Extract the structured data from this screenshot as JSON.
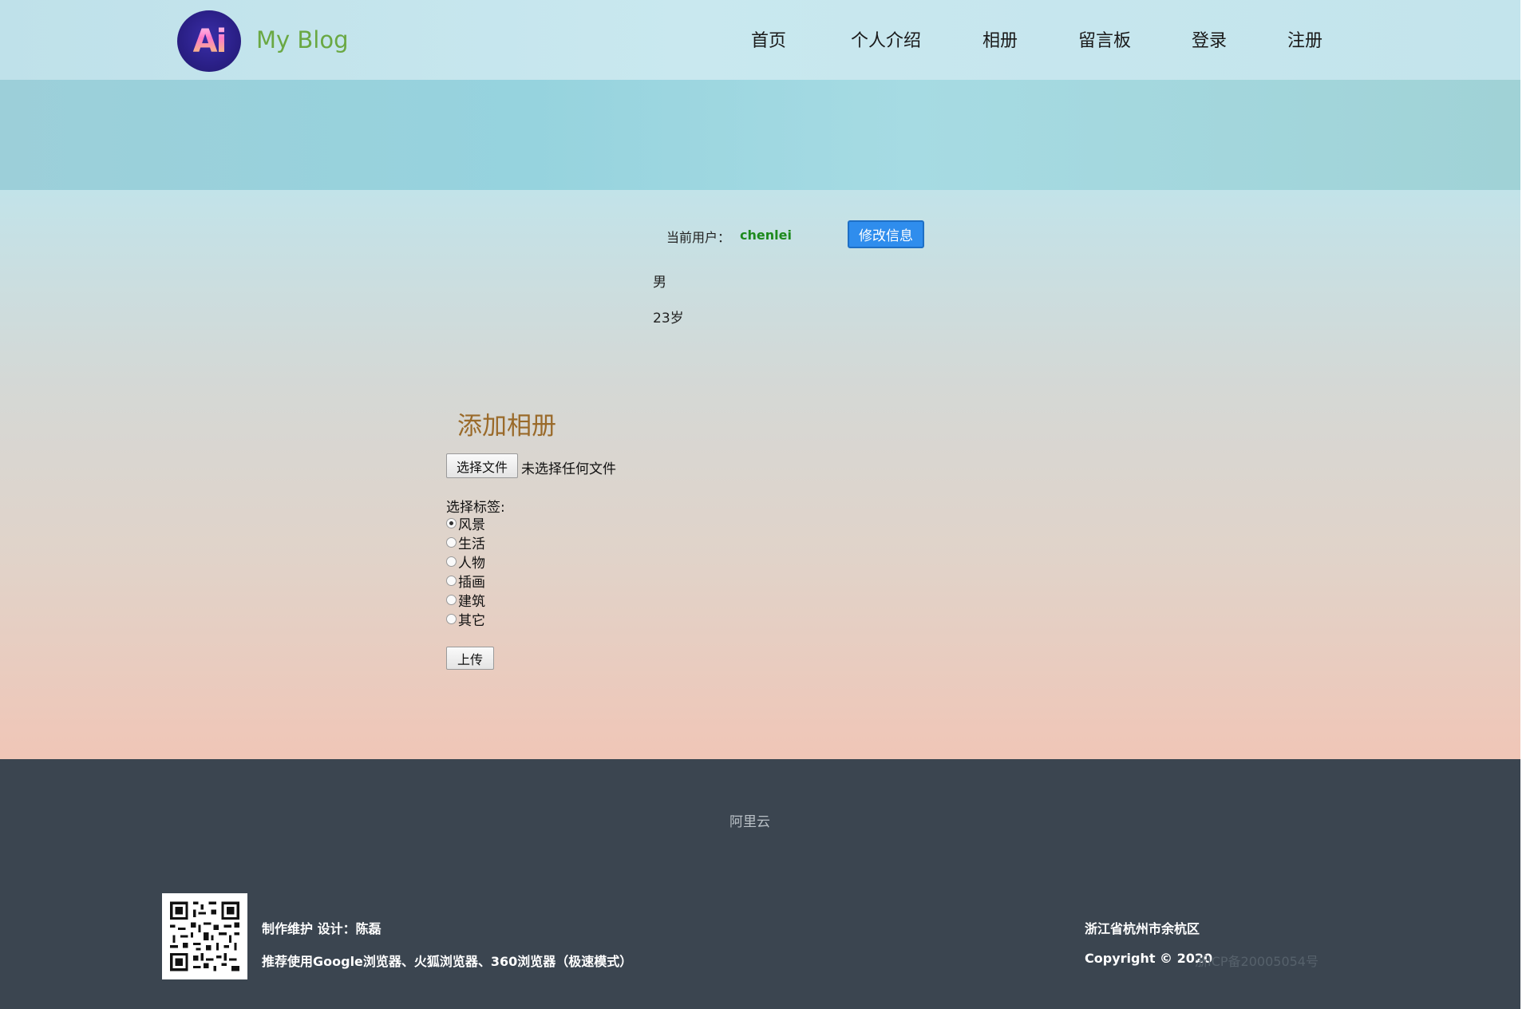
{
  "header": {
    "logo_text": "Ai",
    "site_title": "My Blog",
    "nav": [
      {
        "label": "首页"
      },
      {
        "label": "个人介绍"
      },
      {
        "label": "相册"
      },
      {
        "label": "留言板"
      },
      {
        "label": "登录"
      },
      {
        "label": "注册"
      }
    ]
  },
  "profile": {
    "current_user_label": "当前用户：",
    "username": "chenlei",
    "edit_button": "修改信息",
    "gender": "男",
    "age": "23岁"
  },
  "album_form": {
    "heading": "添加相册",
    "file_button": "选择文件",
    "file_status": "未选择任何文件",
    "tag_label": "选择标签:",
    "tags": [
      {
        "label": "风景",
        "checked": true
      },
      {
        "label": "生活",
        "checked": false
      },
      {
        "label": "人物",
        "checked": false
      },
      {
        "label": "插画",
        "checked": false
      },
      {
        "label": "建筑",
        "checked": false
      },
      {
        "label": "其它",
        "checked": false
      }
    ],
    "upload_button": "上传"
  },
  "footer": {
    "link": "阿里云",
    "credit": "制作维护 设计：陈磊",
    "browser_tip": "推荐使用Google浏览器、火狐浏览器、360浏览器（极速模式）",
    "address": "浙江省杭州市余杭区",
    "copyright": "Copyright © 2020",
    "icp": "浙ICP备20005054号",
    "qr_icon": "qr-code-icon"
  },
  "colors": {
    "accent_button": "#2f8ded",
    "username": "#1d8a1d",
    "heading": "#9a6a2a",
    "footer_bg": "#3b4550",
    "logo_title": "#6aa843"
  }
}
